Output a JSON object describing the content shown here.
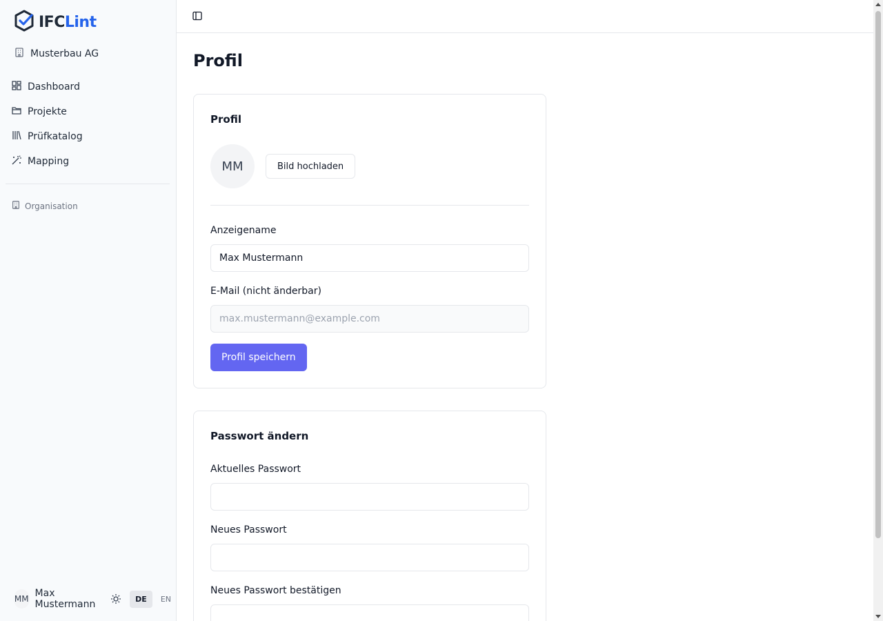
{
  "app": {
    "logo_part1": "IFC",
    "logo_part2": "Lint",
    "organization": "Musterbau AG"
  },
  "sidebar": {
    "nav": [
      {
        "label": "Dashboard",
        "icon": "dashboard-icon"
      },
      {
        "label": "Projekte",
        "icon": "folder-icon"
      },
      {
        "label": "Prüfkatalog",
        "icon": "library-icon"
      },
      {
        "label": "Mapping",
        "icon": "wand-icon"
      }
    ],
    "section_label": "Organisation",
    "user": {
      "initials": "MM",
      "name": "Max Mustermann"
    },
    "languages": [
      "DE",
      "EN"
    ],
    "active_language": "DE"
  },
  "page": {
    "title": "Profil"
  },
  "profile_card": {
    "title": "Profil",
    "avatar_initials": "MM",
    "upload_label": "Bild hochladen",
    "display_name_label": "Anzeigename",
    "display_name_value": "Max Mustermann",
    "email_label": "E-Mail (nicht änderbar)",
    "email_value": "max.mustermann@example.com",
    "save_label": "Profil speichern"
  },
  "password_card": {
    "title": "Passwort ändern",
    "current_label": "Aktuelles Passwort",
    "new_label": "Neues Passwort",
    "confirm_label": "Neues Passwort bestätigen"
  },
  "colors": {
    "primary": "#6366f1",
    "brand_blue": "#2563eb",
    "sidebar_bg": "#f8fafc",
    "border": "#e5e7eb"
  }
}
